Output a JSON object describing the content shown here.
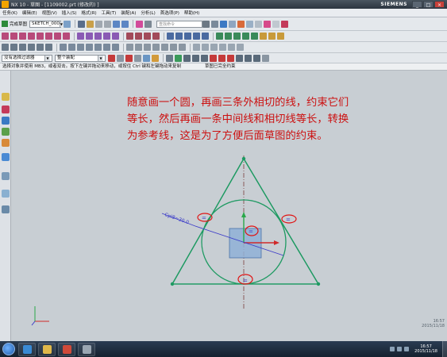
{
  "window": {
    "app_title": "NX 10 - 草图 - [1109002.prt (修改的) ]",
    "brand": "SIEMENS",
    "minimize": "_",
    "maximize": "□",
    "close": "×"
  },
  "menubar": {
    "items": [
      "任务(K)",
      "编辑(E)",
      "视图(V)",
      "插入(S)",
      "格式(R)",
      "工具(T)",
      "装配(A)",
      "分析(L)",
      "首选项(P)",
      "帮助(H)"
    ]
  },
  "toolbar": {
    "finish_sketch": "完成草图",
    "sketch_name": "SKETCH_000",
    "search_placeholder": "查找命令"
  },
  "selection_bar": {
    "filter": "没有选择过滤器",
    "scope": "整个装配"
  },
  "cue_line": {
    "left": "选择对象并使用 MB3，或者双击。按下左键并拖动来移动，或按住 Ctrl 键和左键拖动来复制",
    "right": "草图已完全约束"
  },
  "canvas": {
    "note": "随意画一个圆，再画三条外相切的线，约束它们等长，然后再画一条中间线和相切线等长，转换为参考线，这是为了方便后面草图的约束。",
    "dimension_label": "Cpl8=30.0",
    "colors": {
      "geometry": "#1e9a62",
      "reference_line": "#8a5a5a",
      "annotation": "#e01414",
      "dimension": "#3a3ac8",
      "square_fill": "#8fb0d6"
    }
  },
  "status": {
    "time": "16:57",
    "date": "2015/11/18"
  }
}
